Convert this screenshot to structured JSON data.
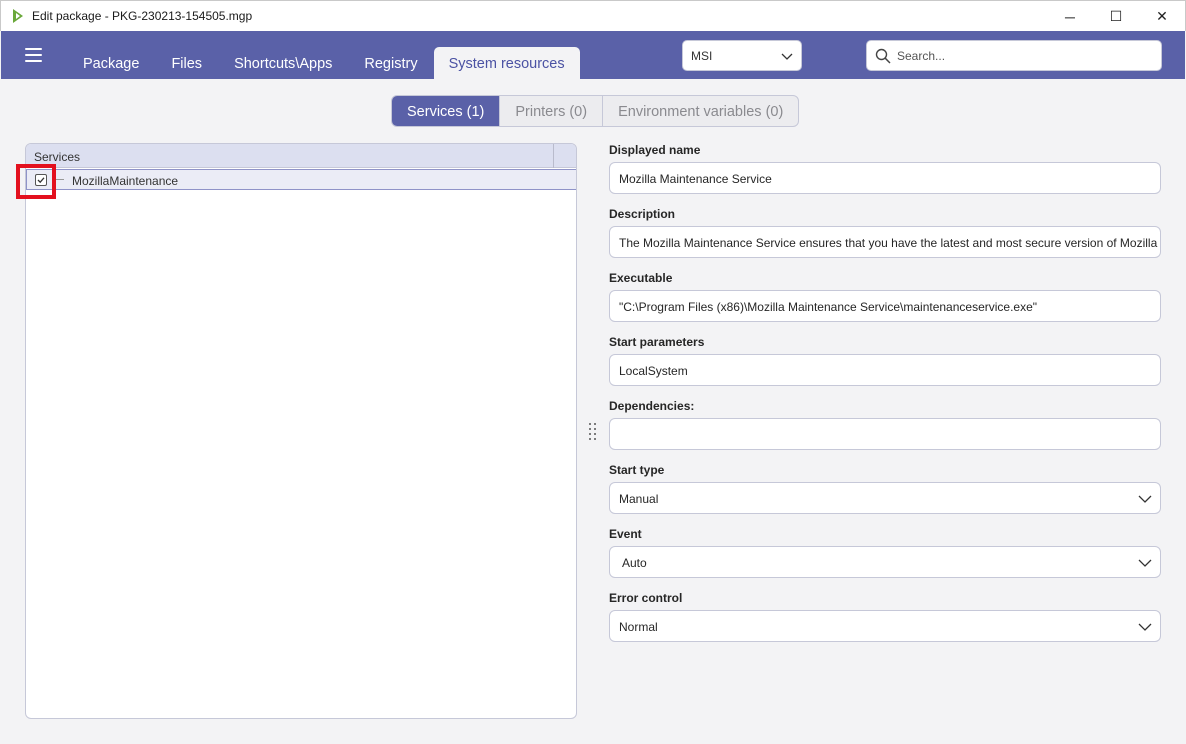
{
  "window": {
    "title": "Edit package - PKG-230213-154505.mgp",
    "minimize": "─",
    "maximize": "☐",
    "close": "✕"
  },
  "nav": {
    "tabs": [
      {
        "label": "Package"
      },
      {
        "label": "Files"
      },
      {
        "label": "Shortcuts\\Apps"
      },
      {
        "label": "Registry"
      },
      {
        "label": "System resources"
      }
    ],
    "active_tab": "System resources",
    "format_select": "MSI",
    "search_placeholder": "Search..."
  },
  "subtabs": [
    {
      "label": "Services (1)"
    },
    {
      "label": "Printers (0)"
    },
    {
      "label": "Environment variables (0)"
    }
  ],
  "tree": {
    "header": "Services",
    "items": [
      {
        "label": "MozillaMaintenance",
        "checked": true
      }
    ]
  },
  "form": {
    "displayed_name": {
      "label": "Displayed name",
      "value": "Mozilla Maintenance Service"
    },
    "description": {
      "label": "Description",
      "value": "The Mozilla Maintenance Service ensures that you have the latest and most secure version of Mozilla"
    },
    "executable": {
      "label": "Executable",
      "value": "\"C:\\Program Files (x86)\\Mozilla Maintenance Service\\maintenanceservice.exe\""
    },
    "start_parameters": {
      "label": "Start parameters",
      "value": "LocalSystem"
    },
    "dependencies": {
      "label": "Dependencies:",
      "value": ""
    },
    "start_type": {
      "label": "Start type",
      "value": "Manual"
    },
    "event": {
      "label": "Event",
      "value": "Auto"
    },
    "error_control": {
      "label": "Error control",
      "value": "Normal"
    }
  },
  "icons": [
    "app-icon",
    "hamburger-menu-icon",
    "chevron-down-icon",
    "search-icon",
    "checkbox-checked-icon",
    "splitter-grip-icon"
  ],
  "colors": {
    "accent": "#5a61a8",
    "highlight": "#e3101e",
    "background": "#f3f3f5"
  }
}
